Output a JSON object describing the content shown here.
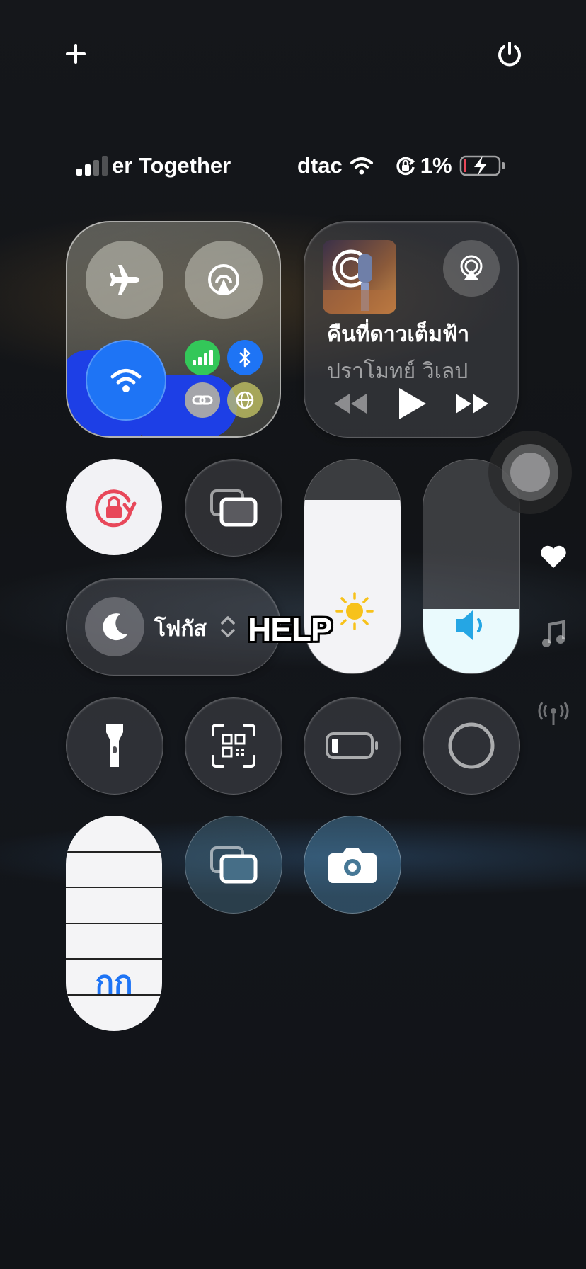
{
  "status_bar": {
    "carrier_left": "er Together",
    "carrier_right": "dtac",
    "battery_percent": "1%",
    "battery_level": 0.01,
    "orientation_lock_icon": "orientation-lock-icon",
    "wifi_icon": "wifi-icon",
    "signal_icon": "signal-bars-icon"
  },
  "top_bar": {
    "add_icon": "plus-icon",
    "power_icon": "power-icon"
  },
  "connectivity": {
    "airplane_icon": "airplane-icon",
    "airdrop_icon": "airdrop-icon",
    "wifi_icon": "wifi-icon",
    "cellular_icon": "cellular-icon",
    "bluetooth_icon": "bluetooth-icon",
    "hotspot_icon": "hotspot-icon",
    "vpn_icon": "globe-icon"
  },
  "media": {
    "track_title": "คืนที่ดาวเต็มฟ้า",
    "artist": "ปราโมทย์ วิเลป",
    "airplay_icon": "airplay-icon"
  },
  "focus": {
    "label": "โฟกัส",
    "icon": "moon-icon"
  },
  "overlay_text": "HELP",
  "brightness": {
    "level": 0.81,
    "icon": "sun-icon"
  },
  "volume": {
    "level": 0.3,
    "icon": "speaker-icon"
  },
  "text_size": {
    "label": "กก"
  },
  "colors": {
    "accent_blue": "#1e74f5",
    "red_lock": "#e8485a",
    "volume_blue": "#25a6e4",
    "sun_yellow": "#f7c21b"
  }
}
